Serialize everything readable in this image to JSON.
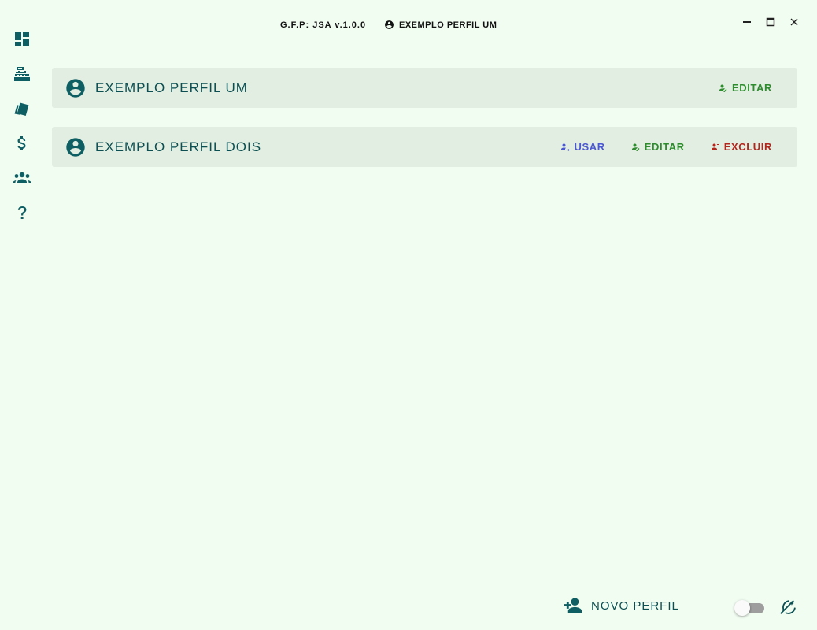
{
  "window": {
    "app_version": "G.F.P: JSA v.1.0.0",
    "active_profile": "EXEMPLO PERFIL UM",
    "controls": [
      "minimize",
      "maximize",
      "close"
    ]
  },
  "nav": {
    "items": [
      {
        "name": "dashboard-icon"
      },
      {
        "name": "cash-register-icon"
      },
      {
        "name": "cards-icon"
      },
      {
        "name": "dollar-icon"
      },
      {
        "name": "people-icon"
      },
      {
        "name": "help-icon"
      }
    ]
  },
  "profiles": [
    {
      "name": "EXEMPLO PERFIL UM",
      "actions": {
        "edit": "EDITAR"
      }
    },
    {
      "name": "EXEMPLO PERFIL DOIS",
      "actions": {
        "use": "USAR",
        "edit": "EDITAR",
        "delete": "EXCLUIR"
      }
    }
  ],
  "footer": {
    "new_profile_label": "NOVO PERFIL",
    "dark_mode_on": false
  },
  "colors": {
    "background": "#f2fdf2",
    "card": "#e1eee1",
    "primary": "#0d5f63",
    "use": "#4a57d6",
    "edit": "#2e8b2e",
    "delete": "#b3261e"
  }
}
